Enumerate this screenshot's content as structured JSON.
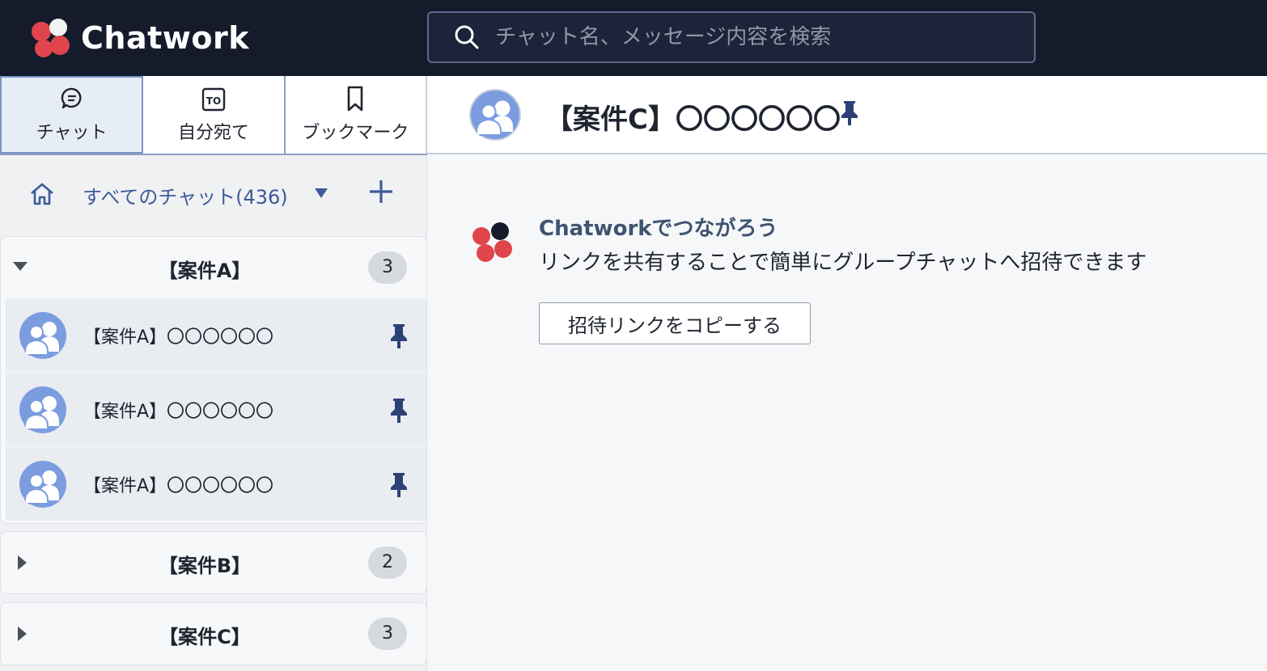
{
  "header": {
    "brand": "Chatwork",
    "search_placeholder": "チャット名、メッセージ内容を検索"
  },
  "tabs": [
    {
      "label": "チャット",
      "icon": "chat-bubble-icon",
      "active": true
    },
    {
      "label": "自分宛て",
      "icon": "to-icon",
      "active": false
    },
    {
      "label": "ブックマーク",
      "icon": "bookmark-icon",
      "active": false
    }
  ],
  "filter": {
    "label": "すべてのチャット(436)"
  },
  "groups": [
    {
      "name": "【案件A】",
      "count": "3",
      "expanded": true,
      "rooms": [
        {
          "name": "【案件A】〇〇〇〇〇〇",
          "pinned": true
        },
        {
          "name": "【案件A】〇〇〇〇〇〇",
          "pinned": true
        },
        {
          "name": "【案件A】〇〇〇〇〇〇",
          "pinned": true
        }
      ]
    },
    {
      "name": "【案件B】",
      "count": "2",
      "expanded": false
    },
    {
      "name": "【案件C】",
      "count": "3",
      "expanded": false
    }
  ],
  "room_header": {
    "title": "【案件C】〇〇〇〇〇〇",
    "pinned": true
  },
  "invite": {
    "title": "Chatworkでつながろう",
    "description": "リンクを共有することで簡単にグループチャットへ招待できます",
    "button_label": "招待リンクをコピーする"
  },
  "colors": {
    "header_bg": "#151b2b",
    "accent_blue": "#3e5a9a",
    "logo_red": "#e0454d",
    "avatar_blue": "#7b9de0"
  }
}
